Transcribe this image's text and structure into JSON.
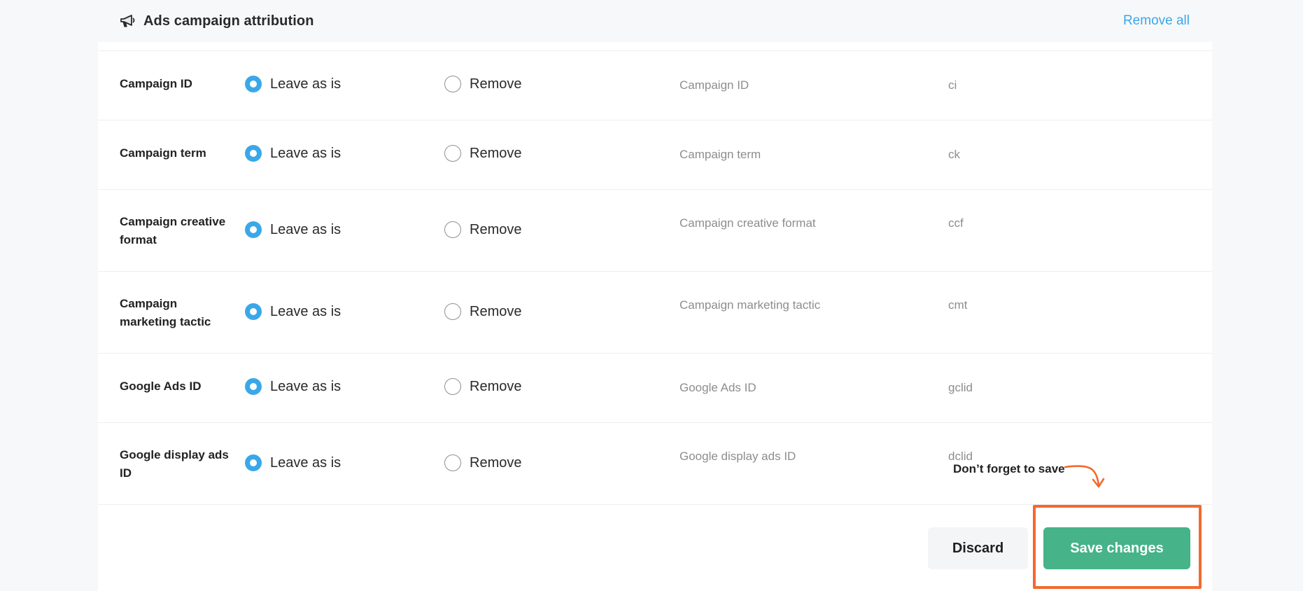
{
  "section": {
    "title": "Ads campaign attribution",
    "icon": "megaphone-icon",
    "remove_all_label": "Remove all"
  },
  "options": {
    "leave_label": "Leave as is",
    "remove_label": "Remove"
  },
  "rows": [
    {
      "label": "Campaign ID",
      "param_name": "Campaign ID",
      "param_key": "ci",
      "selected": "leave"
    },
    {
      "label": "Campaign term",
      "param_name": "Campaign term",
      "param_key": "ck",
      "selected": "leave"
    },
    {
      "label": "Campaign creative format",
      "param_name": "Campaign creative format",
      "param_key": "ccf",
      "selected": "leave"
    },
    {
      "label": "Campaign marketing tactic",
      "param_name": "Campaign marketing tactic",
      "param_key": "cmt",
      "selected": "leave"
    },
    {
      "label": "Google Ads ID",
      "param_name": "Google Ads ID",
      "param_key": "gclid",
      "selected": "leave"
    },
    {
      "label": "Google display ads ID",
      "param_name": "Google display ads ID",
      "param_key": "dclid",
      "selected": "leave"
    }
  ],
  "footer": {
    "discard_label": "Discard",
    "save_label": "Save changes",
    "hint": "Don’t forget to save"
  },
  "colors": {
    "accent": "#3aa8e8",
    "save": "#46b388",
    "highlight": "#f26a2e"
  }
}
